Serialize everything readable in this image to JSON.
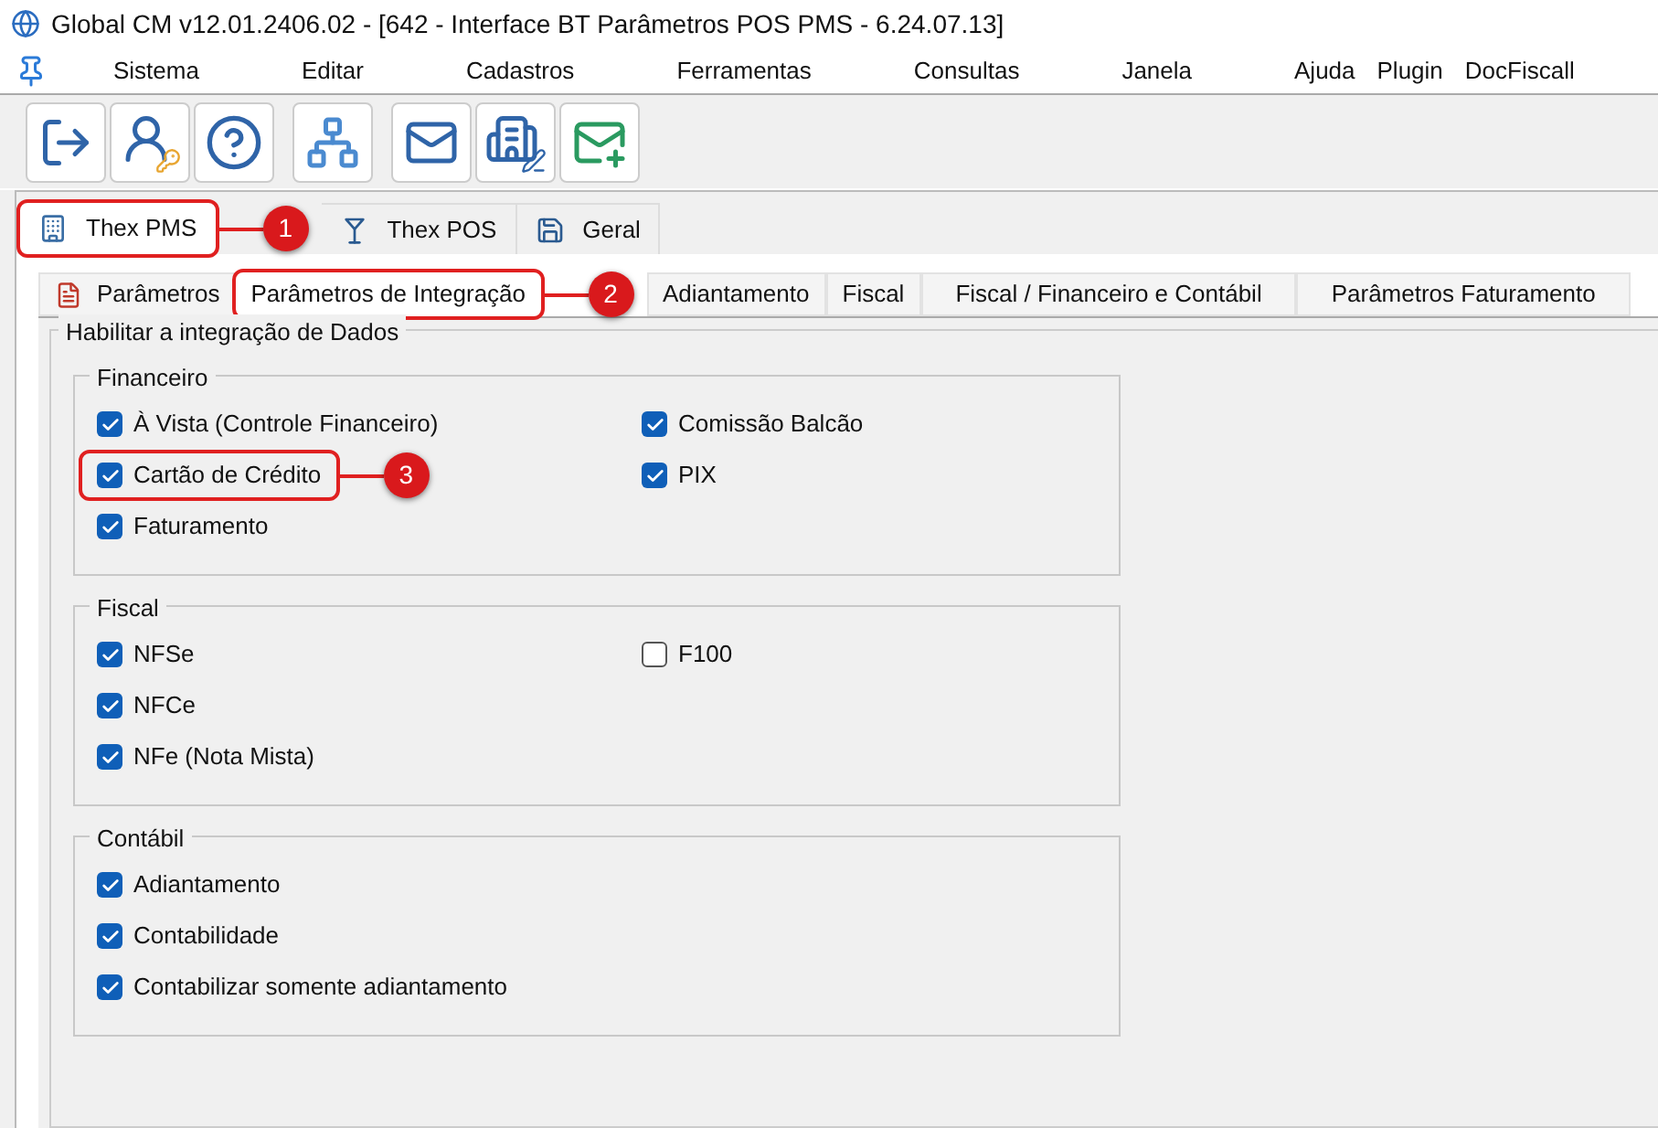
{
  "window": {
    "title": "Global CM v12.01.2406.02 - [642 - Interface BT Parâmetros POS PMS - 6.24.07.13]"
  },
  "menu": [
    "Sistema",
    "Editar",
    "Cadastros",
    "Ferramentas",
    "Consultas",
    "Janela",
    "Ajuda",
    "Plugin",
    "DocFiscall"
  ],
  "module_tabs": [
    {
      "label": "Thex PMS",
      "selected": true,
      "kind": "building",
      "callout": "1"
    },
    {
      "label": "Thex POS",
      "selected": false,
      "kind": "glass"
    },
    {
      "label": "Geral",
      "selected": false,
      "kind": "disk"
    }
  ],
  "sub_tabs": [
    {
      "label": "Parâmetros",
      "selected": false,
      "kind": "doc"
    },
    {
      "label": "Parâmetros de Integração",
      "selected": true,
      "callout": "2"
    },
    {
      "label": "Adiantamento",
      "selected": false
    },
    {
      "label": "Fiscal",
      "selected": false
    },
    {
      "label": "Fiscal / Financeiro e Contábil",
      "selected": false
    },
    {
      "label": "Parâmetros Faturamento",
      "selected": false
    }
  ],
  "panel": {
    "title": "Habilitar a integração de Dados",
    "groups": [
      {
        "title": "Financeiro",
        "left": [
          {
            "label": "À Vista (Controle Financeiro)",
            "checked": true
          },
          {
            "label": "Cartão de Crédito",
            "checked": true,
            "callout": "3"
          },
          {
            "label": "Faturamento",
            "checked": true
          }
        ],
        "right": [
          {
            "label": "Comissão Balcão",
            "checked": true
          },
          {
            "label": "PIX",
            "checked": true
          }
        ]
      },
      {
        "title": "Fiscal",
        "left": [
          {
            "label": "NFSe",
            "checked": true
          },
          {
            "label": "NFCe",
            "checked": true
          },
          {
            "label": "NFe (Nota Mista)",
            "checked": true
          }
        ],
        "right": [
          {
            "label": "F100",
            "checked": false
          }
        ]
      },
      {
        "title": "Contábil",
        "left": [
          {
            "label": "Adiantamento",
            "checked": true
          },
          {
            "label": "Contabilidade",
            "checked": true
          },
          {
            "label": "Contabilizar somente adiantamento",
            "checked": true
          }
        ]
      }
    ]
  }
}
